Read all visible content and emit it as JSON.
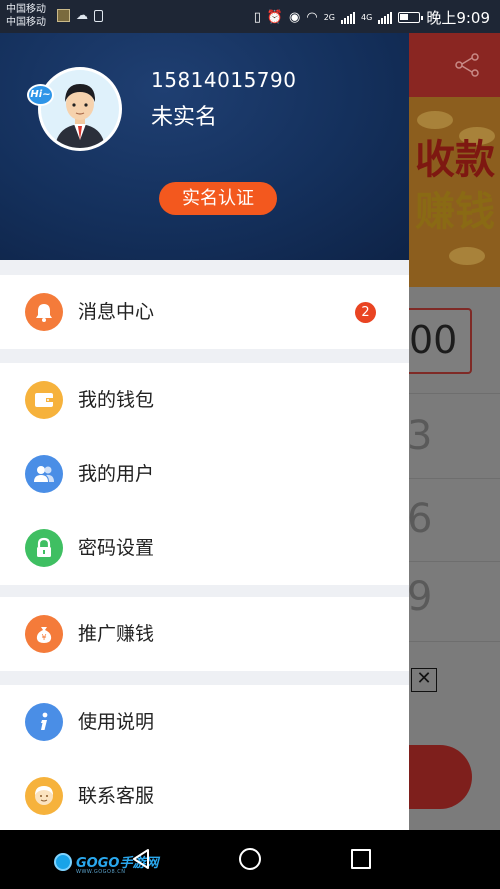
{
  "status_bar": {
    "carrier_1": "中国移动",
    "carrier_2": "中国移动",
    "network_1": "2G",
    "network_2": "4G",
    "time": "晚上9:09"
  },
  "background_app": {
    "banner_line_1": "收款",
    "banner_line_2": "赚钱",
    "input_value": "00",
    "keypad_digits": [
      "3",
      "6",
      "9"
    ]
  },
  "profile": {
    "avatar_badge": "Hi~",
    "phone": "15814015790",
    "verification_status": "未实名",
    "verify_button": "实名认证"
  },
  "menu": [
    {
      "items": [
        {
          "label": "消息中心",
          "icon": "bell-icon",
          "color": "#f47b3a",
          "badge": "2"
        }
      ]
    },
    {
      "items": [
        {
          "label": "我的钱包",
          "icon": "wallet-icon",
          "color": "#f6b23c"
        },
        {
          "label": "我的用户",
          "icon": "users-icon",
          "color": "#4a8ee6"
        },
        {
          "label": "密码设置",
          "icon": "lock-icon",
          "color": "#3fbf62"
        }
      ]
    },
    {
      "items": [
        {
          "label": "推广赚钱",
          "icon": "money-bag-icon",
          "color": "#f47b3a"
        }
      ]
    },
    {
      "items": [
        {
          "label": "使用说明",
          "icon": "info-icon",
          "color": "#4a8ee6"
        },
        {
          "label": "联系客服",
          "icon": "customer-service-icon",
          "color": "#f6b23c"
        }
      ]
    }
  ],
  "watermark": {
    "brand": "GOGO手游网",
    "sub": "WWW.GOGO8.CN"
  },
  "colors": {
    "accent": "#f3581e",
    "header_blue": "#14305c",
    "badge_red": "#e94422"
  }
}
